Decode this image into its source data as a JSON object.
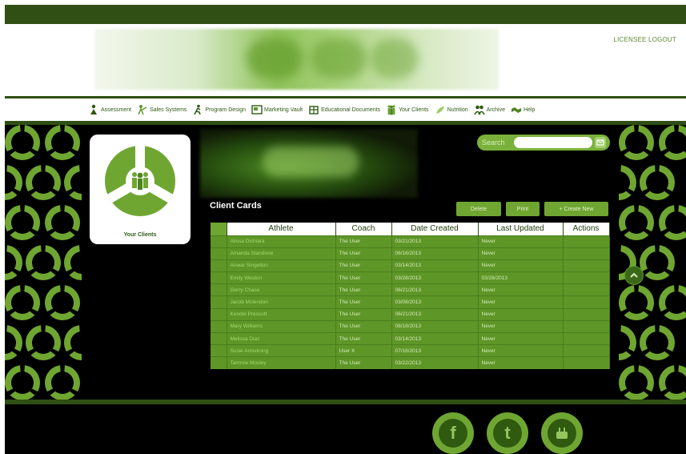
{
  "header": {
    "user_links": "LICENSEE   LOGOUT"
  },
  "nav": {
    "items": [
      {
        "label": "Assessment",
        "icon": "person-icon"
      },
      {
        "label": "Sales Systems",
        "icon": "sales-icon"
      },
      {
        "label": "Program Design",
        "icon": "runner-icon"
      },
      {
        "label": "Marketing Vault",
        "icon": "vault-icon"
      },
      {
        "label": "Educational Documents",
        "icon": "document-icon"
      },
      {
        "label": "Your Clients",
        "icon": "clients-icon"
      },
      {
        "label": "Nutrition",
        "icon": "nutrition-icon"
      },
      {
        "label": "Archive",
        "icon": "archive-icon"
      },
      {
        "label": "Help",
        "icon": "handshake-icon"
      }
    ]
  },
  "sidebar": {
    "card_label": "Your Clients"
  },
  "search": {
    "label": "Search",
    "placeholder": ""
  },
  "client_cards": {
    "title": "Client Cards",
    "buttons": {
      "delete": "Delete",
      "print": "Print",
      "create": "+ Create New"
    },
    "columns": [
      "Athlete",
      "Coach",
      "Date Created",
      "Last Updated",
      "Actions"
    ],
    "rows": [
      {
        "athlete": "Alissa Dichiara",
        "coach": "The User",
        "created": "03/21/2013",
        "updated": "Never",
        "actions": ""
      },
      {
        "athlete": "Amanda Standone",
        "coach": "The User",
        "created": "06/16/2013",
        "updated": "Never",
        "actions": ""
      },
      {
        "athlete": "Anwar Singelton",
        "coach": "The User",
        "created": "03/14/2013",
        "updated": "Never",
        "actions": ""
      },
      {
        "athlete": "Emily Weston",
        "coach": "The User",
        "created": "03/28/2013",
        "updated": "03/28/2013",
        "actions": ""
      },
      {
        "athlete": "Gerry Chase",
        "coach": "The User",
        "created": "06/21/2013",
        "updated": "Never",
        "actions": ""
      },
      {
        "athlete": "Jacob Mclendon",
        "coach": "The User",
        "created": "03/08/2013",
        "updated": "Never",
        "actions": ""
      },
      {
        "athlete": "Kendel Prescott",
        "coach": "The User",
        "created": "06/21/2013",
        "updated": "Never",
        "actions": ""
      },
      {
        "athlete": "Mary Williams",
        "coach": "The User",
        "created": "08/18/2013",
        "updated": "Never",
        "actions": ""
      },
      {
        "athlete": "Melissa Diaz",
        "coach": "The User",
        "created": "03/14/2013",
        "updated": "Never",
        "actions": ""
      },
      {
        "athlete": "Susie Armstrong",
        "coach": "User X",
        "created": "07/16/2013",
        "updated": "Never",
        "actions": ""
      },
      {
        "athlete": "Tammie Mosley",
        "coach": "The User",
        "created": "03/22/2013",
        "updated": "Never",
        "actions": ""
      }
    ]
  },
  "footer": {
    "social": [
      "facebook-icon",
      "twitter-icon",
      "youtube-icon"
    ]
  },
  "colors": {
    "accent": "#6fa632",
    "dark": "#2f4f14",
    "background": "#000000"
  }
}
